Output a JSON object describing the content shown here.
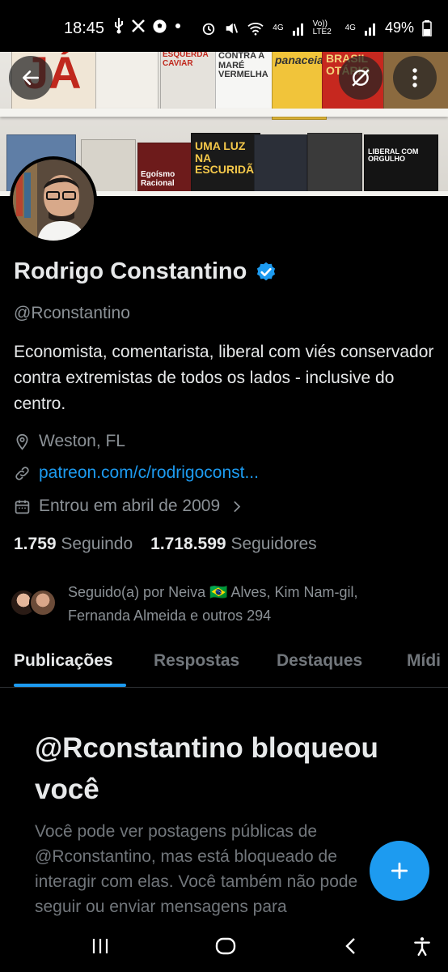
{
  "status_bar": {
    "time": "18:45",
    "left_icons": [
      "usb-icon",
      "x-icon",
      "soccer-icon",
      "dot-icon"
    ],
    "network_labels": [
      "4G",
      "Vo)) LTE2",
      "4G"
    ],
    "battery": "49%"
  },
  "banner": {
    "book_titles": [
      "JÁ",
      "ESQUERDA CAVIAR",
      "CONTRA A MARÉ VERMELHA",
      "panaceia",
      "BRASIL OTÁRIO",
      "UMA LUZ NA ESCURIDÃO",
      "LIBERAL COM ORGULHO",
      "Egoísmo Racional"
    ]
  },
  "profile": {
    "name": "Rodrigo Constantino",
    "handle": "@Rconstantino",
    "bio": "Economista, comentarista, liberal com viés conservador contra extremistas de todos os lados - inclusive do centro.",
    "location": "Weston, FL",
    "link": "patreon.com/c/rodrigoconst...",
    "joined": "Entrou em abril de 2009",
    "following_count": "1.759",
    "following_label": "Seguindo",
    "followers_count": "1.718.599",
    "followers_label": "Seguidores",
    "followed_by": "Seguido(a) por Neiva 🇧🇷 Alves, Kim Nam-gil, Fernanda Almeida e outros 294"
  },
  "tabs": [
    {
      "label": "Publicações"
    },
    {
      "label": "Respostas"
    },
    {
      "label": "Destaques"
    },
    {
      "label": "Mídi"
    }
  ],
  "blocked": {
    "title": "@Rconstantino bloqueou você",
    "text": "Você pode ver postagens públicas de @Rconstantino, mas está bloqueado de interagir com elas. Você também não pode seguir ou enviar mensagens para"
  },
  "colors": {
    "accent": "#1d9bf0",
    "background": "#000000",
    "muted": "#71767b"
  }
}
